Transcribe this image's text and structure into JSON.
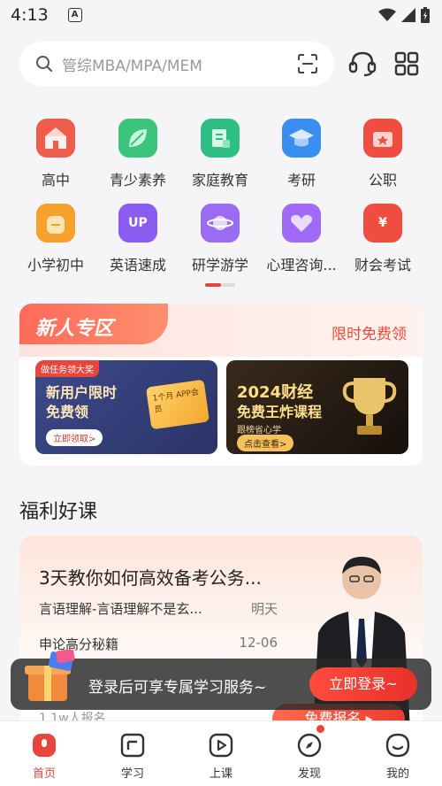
{
  "status_bar": {
    "time": "4:13",
    "app_badge": "A"
  },
  "search": {
    "placeholder": "管综MBA/MPA/MEM"
  },
  "categories": [
    {
      "label": "高中",
      "icon": "school-building-icon",
      "color": "#ee5d4c"
    },
    {
      "label": "青少素养",
      "icon": "leaf-icon",
      "color": "#3cc47a"
    },
    {
      "label": "家庭教育",
      "icon": "notebook-icon",
      "color": "#2fbf84"
    },
    {
      "label": "考研",
      "icon": "graduation-cap-icon",
      "color": "#3a8ef0"
    },
    {
      "label": "公职",
      "icon": "briefcase-icon",
      "color": "#ef4d3f"
    },
    {
      "label": "小学初中",
      "icon": "backpack-icon",
      "color": "#f6a12c"
    },
    {
      "label": "英语速成",
      "icon": "up-badge-icon",
      "color": "#8a5cf0",
      "text": "UP"
    },
    {
      "label": "研学游学",
      "icon": "planet-icon",
      "color": "#9b6cf3"
    },
    {
      "label": "心理咨询...",
      "icon": "heart-icon",
      "color": "#a06af5"
    },
    {
      "label": "财会考试",
      "icon": "yen-bag-icon",
      "color": "#ef4d3f",
      "text": "¥"
    }
  ],
  "new_user_zone": {
    "tag": "新人专区",
    "free_label": "限时免费领",
    "banner1": {
      "ribbon": "做任务领大奖",
      "title_line1": "新用户限时",
      "title_line2": "免费领",
      "button": "立即领取>",
      "card_text": "1个月 APP会员"
    },
    "banner2": {
      "title_line1": "2024财经",
      "title_line2": "免费王炸课程",
      "subtitle": "跟榜省心学",
      "button": "点击查看>"
    }
  },
  "section_title": "福利好课",
  "course": {
    "title": "3天教你如何高效备考公务...",
    "rows": [
      {
        "name": "言语理解-言语理解不是玄...",
        "date": "明天"
      },
      {
        "name": "申论高分秘籍",
        "date": "12-06"
      }
    ],
    "enroll": "1.1w人报名",
    "cta": "免费报名 ▸"
  },
  "toast": {
    "message": "登录后可享专属学习服务~",
    "login_button": "立即登录~"
  },
  "tabbar": [
    {
      "label": "首页",
      "icon": "home-icon",
      "active": true
    },
    {
      "label": "学习",
      "icon": "book-icon"
    },
    {
      "label": "上课",
      "icon": "play-icon"
    },
    {
      "label": "发现",
      "icon": "compass-icon",
      "dot": true
    },
    {
      "label": "我的",
      "icon": "profile-chat-icon"
    }
  ],
  "colors": {
    "accent": "#e8453c"
  }
}
